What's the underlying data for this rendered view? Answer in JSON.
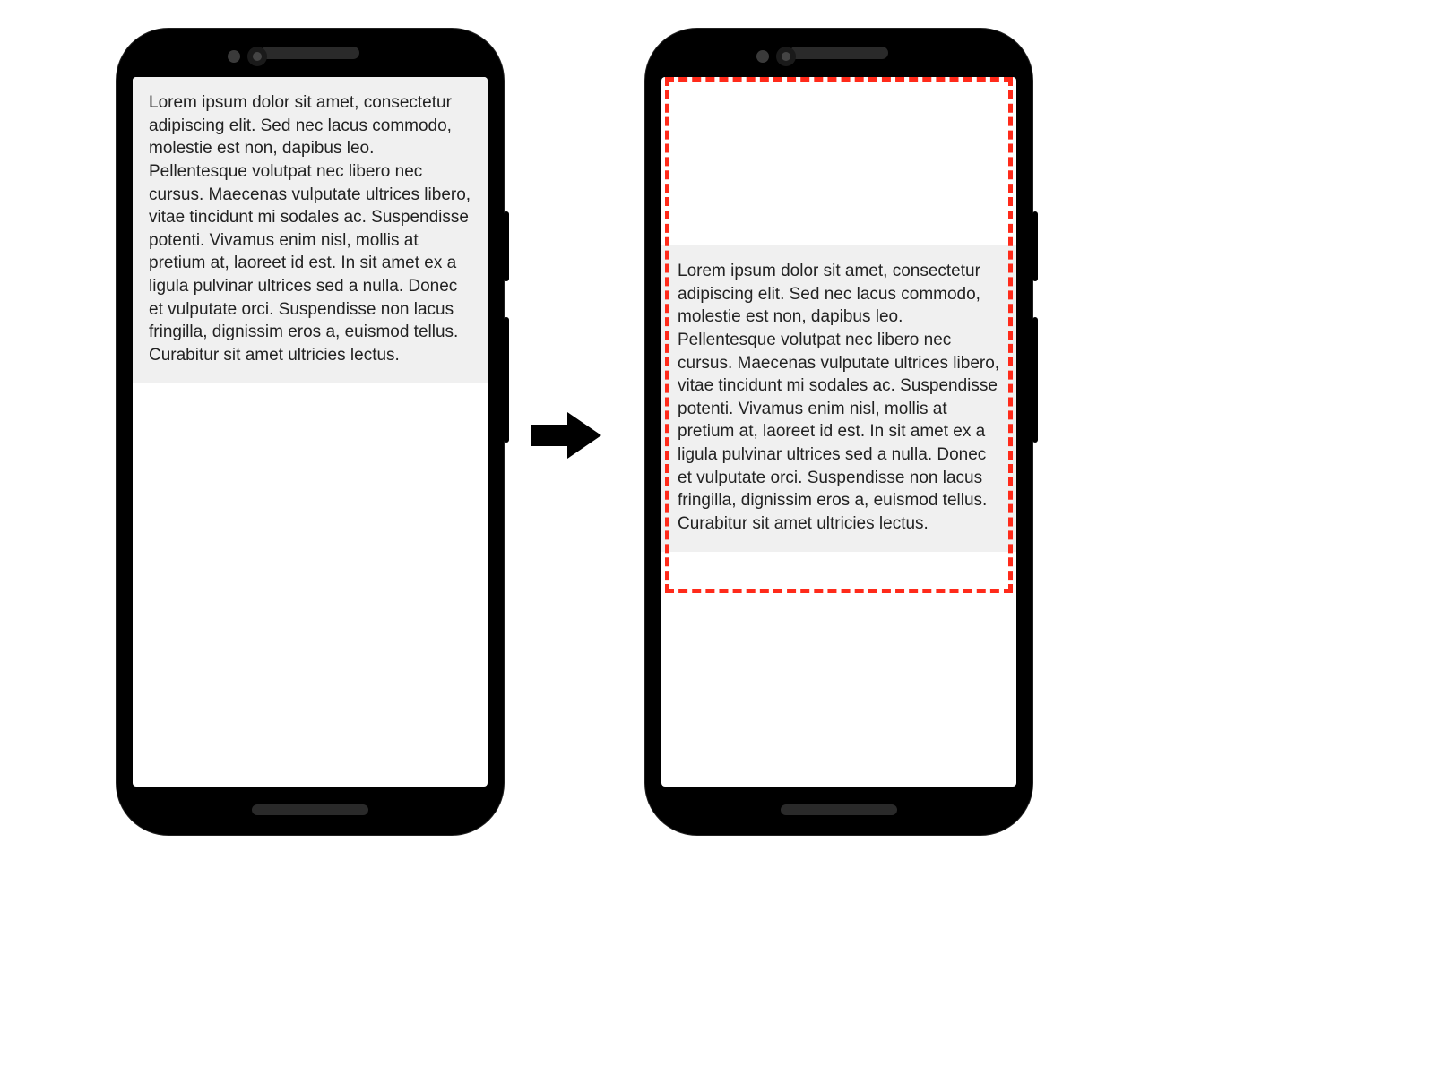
{
  "lorem_text": "Lorem ipsum dolor sit amet, consectetur adipiscing elit. Sed nec lacus commodo, molestie est non, dapibus leo. Pellentesque volutpat nec libero nec cursus. Maecenas vulputate ultrices libero, vitae tincidunt mi sodales ac. Suspendisse potenti. Vivamus enim nisl, mollis at pretium at, laoreet id est. In sit amet ex a ligula pulvinar ultrices sed a nulla. Donec et vulputate orci. Suspendisse non lacus fringilla, dignissim eros a, euismod tellus. Curabitur sit amet ultricies lectus.",
  "colors": {
    "highlight": "#ff2a1a",
    "text_bg": "#f0f0f0"
  }
}
